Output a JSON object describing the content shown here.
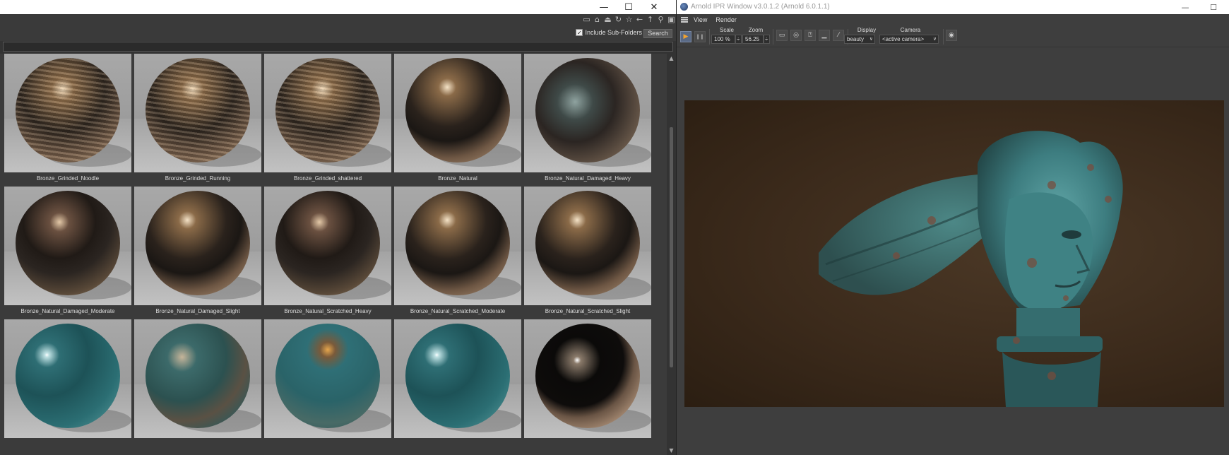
{
  "left_window": {
    "window_controls": {
      "minimize": "—",
      "maximize": "☐",
      "close": "✕"
    },
    "toolbar_icons": [
      "minus-box-icon",
      "home-icon",
      "up-folder-icon",
      "refresh-icon",
      "star-icon",
      "back-arrow-icon",
      "up-arrow-icon",
      "zoom-icon",
      "add-icon"
    ],
    "toolbar_glyphs": [
      "▭",
      "⌂",
      "⏏",
      "↻",
      "☆",
      "←",
      "↑",
      "⚲",
      "▣"
    ],
    "include_subfolders": {
      "label": "Include Sub-Folders",
      "checked": true,
      "check_glyph": "✓"
    },
    "search_button": "Search",
    "search_value": "",
    "scroll": {
      "up": "▲",
      "down": "▼"
    },
    "materials": [
      {
        "name": "Bronze_Grinded_Noodle",
        "style": "b-grind"
      },
      {
        "name": "Bronze_Grinded_Running",
        "style": "b-grind"
      },
      {
        "name": "Bronze_Grinded_shattered",
        "style": "b-grind"
      },
      {
        "name": "Bronze_Natural",
        "style": "b-bronze"
      },
      {
        "name": "Bronze_Natural_Damaged_Heavy",
        "style": "b-heavy"
      },
      {
        "name": "Bronze_Natural_Damaged_Moderate",
        "style": "b-damaged"
      },
      {
        "name": "Bronze_Natural_Damaged_Slight",
        "style": "b-bronze"
      },
      {
        "name": "Bronze_Natural_Scratched_Heavy",
        "style": "b-damaged"
      },
      {
        "name": "Bronze_Natural_Scratched_Moderate",
        "style": "b-bronze"
      },
      {
        "name": "Bronze_Natural_Scratched_Slight",
        "style": "b-bronze"
      },
      {
        "name": "",
        "style": "b-teal"
      },
      {
        "name": "",
        "style": "b-tealrust"
      },
      {
        "name": "",
        "style": "b-tealchip"
      },
      {
        "name": "",
        "style": "b-teal"
      },
      {
        "name": "",
        "style": "b-chrome"
      }
    ]
  },
  "right_window": {
    "title": "Arnold IPR Window v3.0.1.2 (Arnold 6.0.1.1)",
    "window_controls": {
      "minimize": "—",
      "maximize": "☐"
    },
    "menu": [
      "View",
      "Render"
    ],
    "toolbar": {
      "play_glyph": "▶",
      "pause_glyph": "❙❙",
      "scale_label": "Scale",
      "scale_value": "100 %",
      "zoom_label": "Zoom",
      "zoom_value": "56.25",
      "spin_glyph": "÷",
      "display_label": "Display",
      "display_value": "beauty",
      "camera_label": "Camera",
      "camera_value": "<active camera>",
      "dropdown_glyph": "∨",
      "view_buttons": [
        "▭",
        "◎",
        "⍰",
        "▁",
        "⁄"
      ],
      "snapshot_glyph": "◉"
    },
    "colors": {
      "viewport_bg": "#3b2a1b",
      "statue_teal": "#4a8e90",
      "accent_play": "#f3a330"
    }
  }
}
